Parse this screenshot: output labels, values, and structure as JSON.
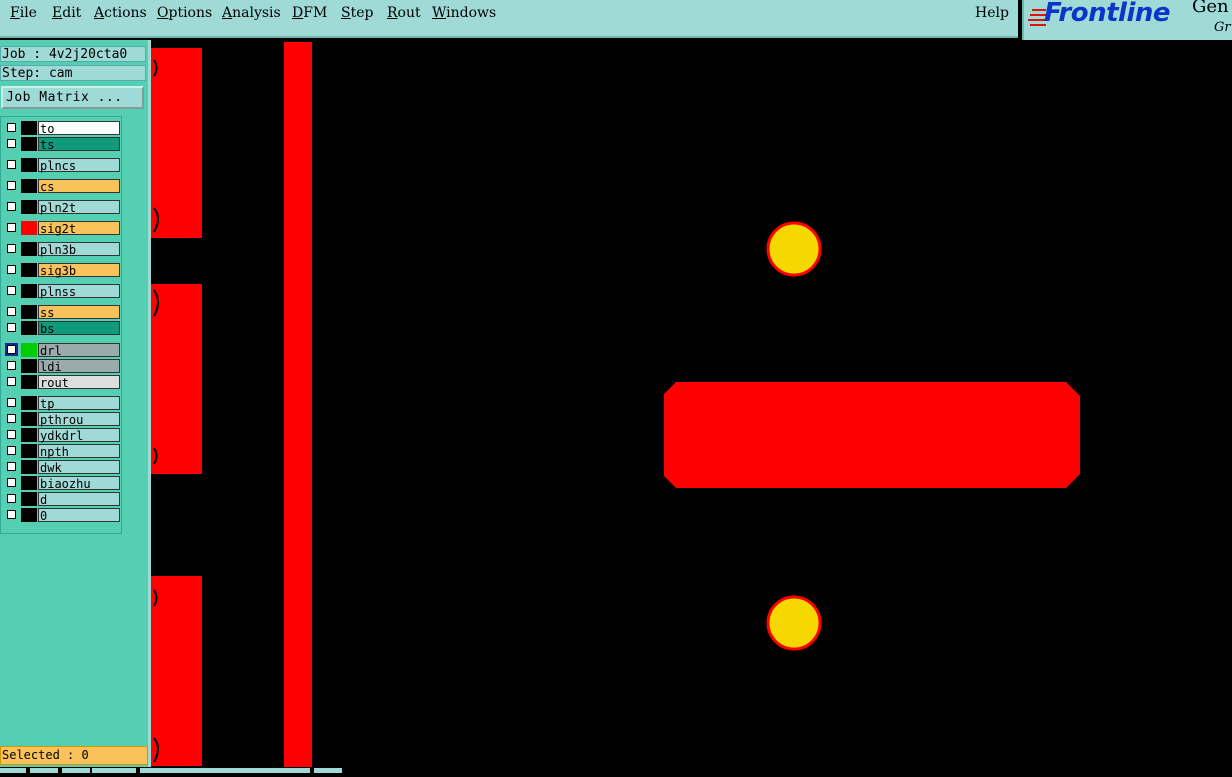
{
  "menu": {
    "items": [
      "File",
      "Edit",
      "Actions",
      "Options",
      "Analysis",
      "DFM",
      "Step",
      "Rout",
      "Windows"
    ],
    "help": "Help"
  },
  "logo": {
    "brand": "Frontline",
    "sub1": "Gen",
    "sub2": "Gr"
  },
  "job": {
    "label": "Job : 4v2j20cta0",
    "step": "Step: cam",
    "matrix_button": "Job Matrix ..."
  },
  "layers": [
    {
      "name": "to",
      "color": "#ffffff",
      "swatch": "#000000"
    },
    {
      "name": "ts",
      "color": "#10997a",
      "swatch": "#000000"
    },
    {
      "name": "plncs",
      "color": "#9fdad6",
      "swatch": "#000000"
    },
    {
      "name": "cs",
      "color": "#f9c25a",
      "swatch": "#000000"
    },
    {
      "name": "pln2t",
      "color": "#9fdad6",
      "swatch": "#000000"
    },
    {
      "name": "sig2t",
      "color": "#f9c25a",
      "swatch": "#ff0000"
    },
    {
      "name": "pln3b",
      "color": "#9fdad6",
      "swatch": "#000000"
    },
    {
      "name": "sig3b",
      "color": "#f9c25a",
      "swatch": "#000000"
    },
    {
      "name": "plnss",
      "color": "#9fdad6",
      "swatch": "#000000"
    },
    {
      "name": "ss",
      "color": "#f9c25a",
      "swatch": "#000000"
    },
    {
      "name": "bs",
      "color": "#10997a",
      "swatch": "#000000"
    },
    {
      "name": "drl",
      "color": "#9aaaad",
      "swatch": "#00cc00",
      "checked": true
    },
    {
      "name": "ldi",
      "color": "#9aaaad",
      "swatch": "#000000"
    },
    {
      "name": "rout",
      "color": "#dedede",
      "swatch": "#000000"
    },
    {
      "name": "tp",
      "color": "#9fdad6",
      "swatch": "#000000"
    },
    {
      "name": "pthrou",
      "color": "#9fdad6",
      "swatch": "#000000"
    },
    {
      "name": "ydkdrl",
      "color": "#9fdad6",
      "swatch": "#000000"
    },
    {
      "name": "npth",
      "color": "#9fdad6",
      "swatch": "#000000"
    },
    {
      "name": "dwk",
      "color": "#9fdad6",
      "swatch": "#000000"
    },
    {
      "name": "biaozhu",
      "color": "#9fdad6",
      "swatch": "#000000"
    },
    {
      "name": "d",
      "color": "#9fdad6",
      "swatch": "#000000"
    },
    {
      "name": "0",
      "color": "#9fdad6",
      "swatch": "#000000"
    }
  ],
  "status": {
    "selected": "Selected : 0"
  },
  "colors": {
    "copper": "#ff0000",
    "pad": "#f5d800",
    "background": "#000000",
    "panel": "#55cfb2",
    "bar": "#9fdad6"
  }
}
